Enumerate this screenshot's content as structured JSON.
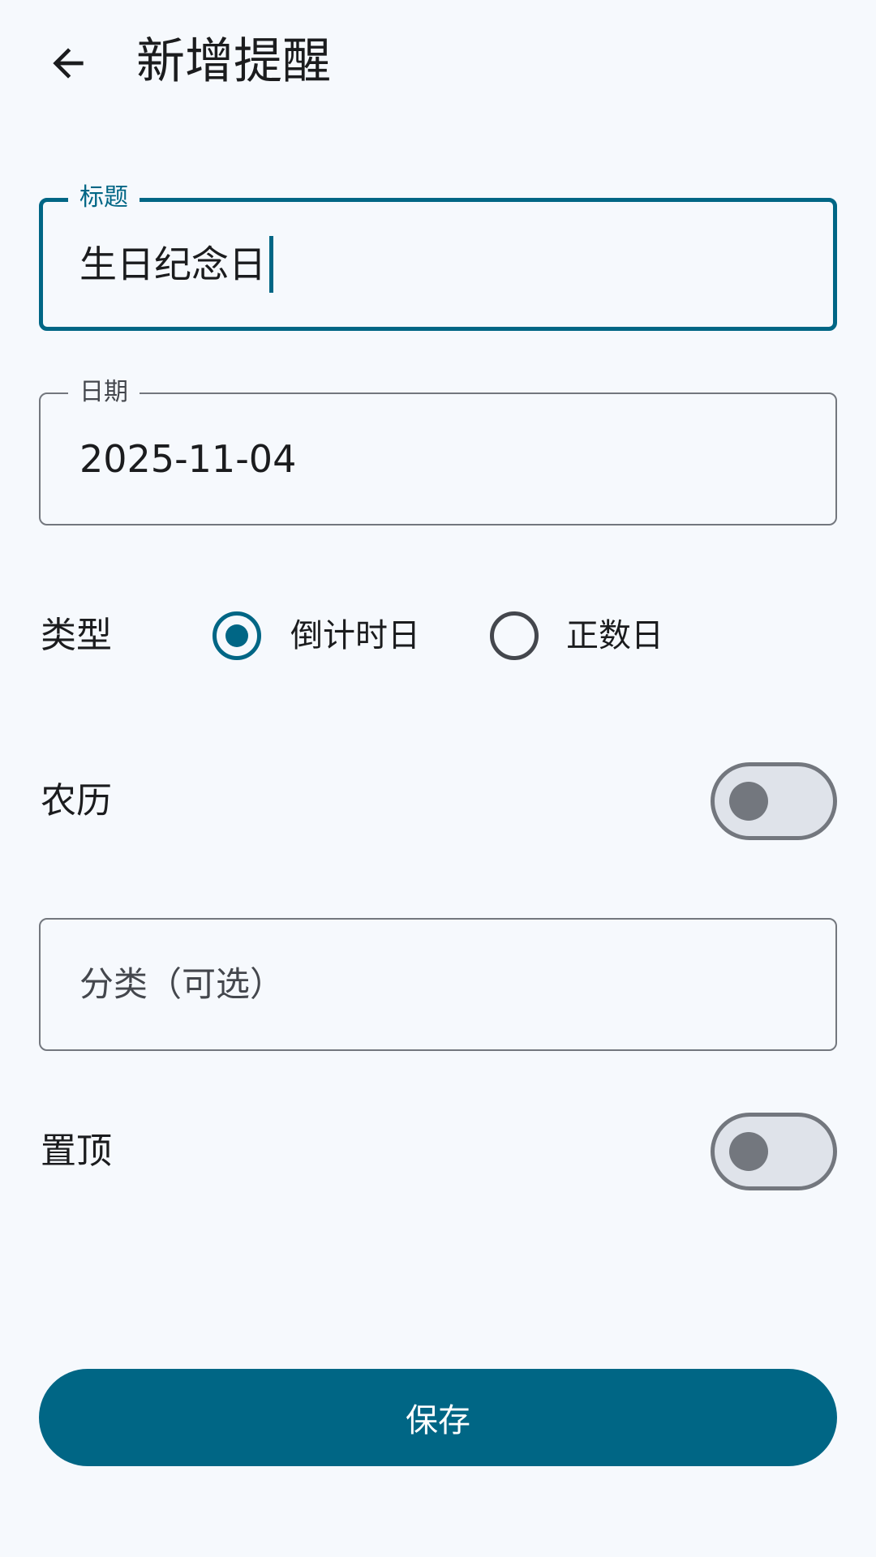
{
  "header": {
    "back_icon": "arrow-back-icon",
    "title": "新增提醒"
  },
  "form": {
    "title_field": {
      "label": "标题",
      "value": "生日纪念日",
      "focused": true
    },
    "date_field": {
      "label": "日期",
      "value": "2025-11-04"
    },
    "type": {
      "label": "类型",
      "options": [
        {
          "label": "倒计时日",
          "selected": true
        },
        {
          "label": "正数日",
          "selected": false
        }
      ]
    },
    "lunar": {
      "label": "农历",
      "on": false
    },
    "category_field": {
      "placeholder": "分类（可选）",
      "value": ""
    },
    "pinned": {
      "label": "置顶",
      "on": false
    }
  },
  "actions": {
    "save_label": "保存"
  },
  "colors": {
    "primary": "#006685",
    "background": "#f6f9fd",
    "outline": "#73777e",
    "switch_track_off": "#dfe3ea"
  }
}
